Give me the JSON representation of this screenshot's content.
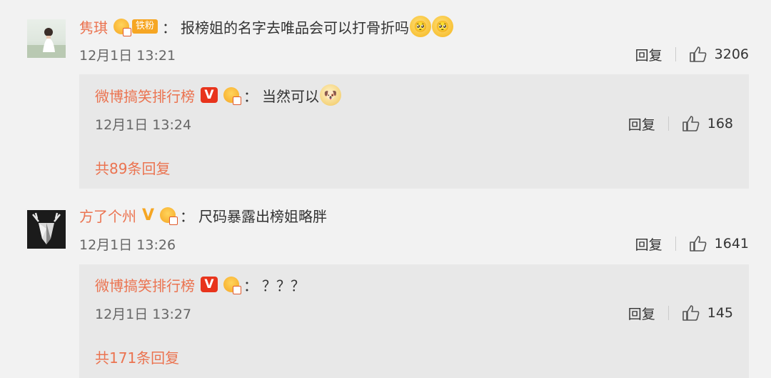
{
  "comments": [
    {
      "username": "隽琪",
      "fan_badge": "铁粉",
      "separator": "：",
      "text": "报榜姐的名字去唯品会可以打骨折吗",
      "emojis": [
        "🥺",
        "🥺"
      ],
      "time": "12月1日 13:21",
      "reply_label": "回复",
      "likes": "3206",
      "sub_reply": {
        "username": "微博搞笑排行榜",
        "v_label": "V",
        "separator": "：",
        "text": "当然可以",
        "emojis": [
          "🐶"
        ],
        "time": "12月1日 13:24",
        "reply_label": "回复",
        "likes": "168"
      },
      "more_replies": "共89条回复"
    },
    {
      "username": "方了个州",
      "v_label": "V",
      "separator": "：",
      "text": "尺码暴露出榜姐略胖",
      "time": "12月1日 13:26",
      "reply_label": "回复",
      "likes": "1641",
      "sub_reply": {
        "username": "微博搞笑排行榜",
        "v_label": "V",
        "separator": "：",
        "text": "？？？",
        "time": "12月1日 13:27",
        "reply_label": "回复",
        "likes": "145"
      },
      "more_replies": "共171条回复"
    }
  ],
  "colors": {
    "username": "#eb7350",
    "background": "#f2f2f2",
    "reply_box": "#e8e8e8",
    "v_badge": "#e8341c",
    "gold": "#f6a623"
  },
  "icons": [
    "thumb-up-icon",
    "vip-crown-icon",
    "verified-v-icon"
  ]
}
